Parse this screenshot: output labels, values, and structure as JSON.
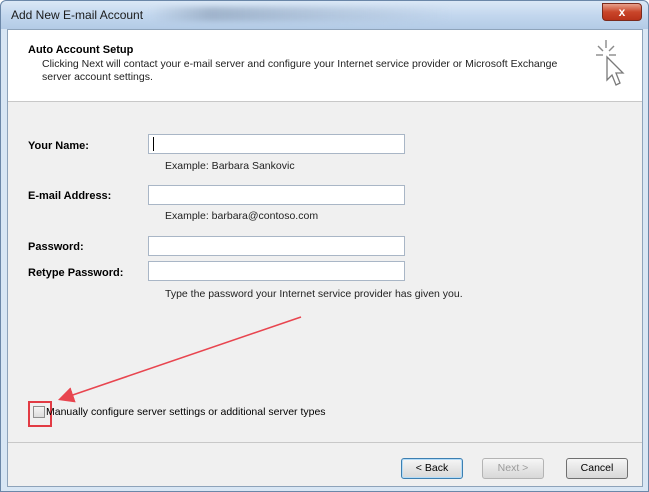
{
  "window": {
    "title": "Add New E-mail Account",
    "close_label": "x"
  },
  "header": {
    "section_title": "Auto Account Setup",
    "description": "Clicking Next will contact your e-mail server and configure your Internet service provider or Microsoft Exchange server account settings."
  },
  "form": {
    "your_name": {
      "label": "Your Name:",
      "value": "",
      "example": "Example: Barbara Sankovic"
    },
    "email": {
      "label": "E-mail Address:",
      "value": "",
      "example": "Example: barbara@contoso.com"
    },
    "password": {
      "label": "Password:",
      "value": ""
    },
    "retype_password": {
      "label": "Retype Password:",
      "value": ""
    },
    "password_hint": "Type the password your Internet service provider has given you."
  },
  "manual_config": {
    "label": "Manually configure server settings or additional server types",
    "checked": false
  },
  "buttons": {
    "back": "< Back",
    "next": "Next >",
    "cancel": "Cancel"
  },
  "colors": {
    "annotation_arrow": "#e8454f",
    "annotation_box": "#e23b44"
  }
}
